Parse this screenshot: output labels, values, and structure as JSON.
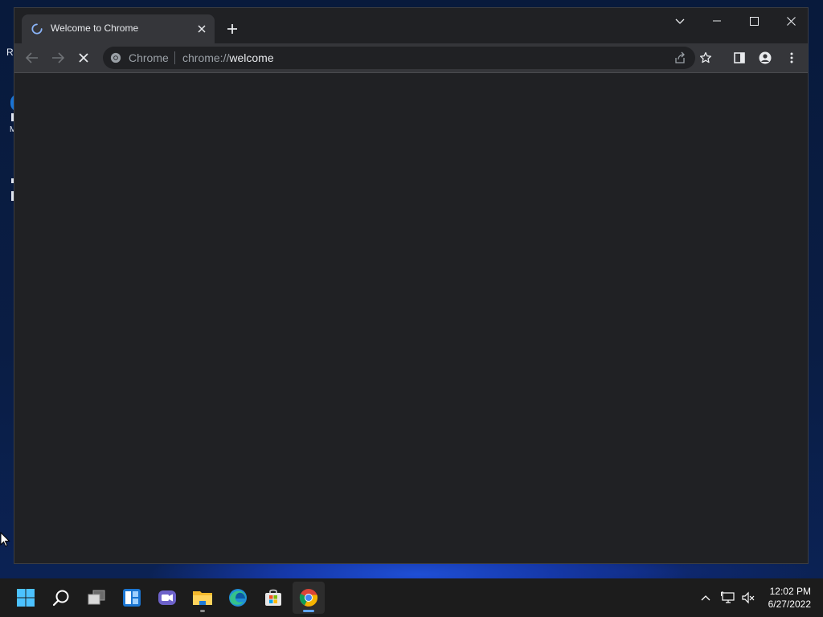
{
  "desktop": {
    "partial_labels": [
      "Re",
      "M"
    ]
  },
  "browser": {
    "tab": {
      "title": "Welcome to Chrome"
    },
    "omnibox": {
      "chip_label": "Chrome",
      "url_scheme": "chrome://",
      "url_host": "welcome"
    }
  },
  "taskbar": {
    "apps": [
      {
        "name": "start",
        "icon": "windows-logo-icon"
      },
      {
        "name": "search",
        "icon": "search-icon"
      },
      {
        "name": "task-view",
        "icon": "task-view-icon"
      },
      {
        "name": "widgets",
        "icon": "widgets-icon"
      },
      {
        "name": "teams-chat",
        "icon": "chat-icon"
      },
      {
        "name": "file-explorer",
        "icon": "folder-icon",
        "running": true
      },
      {
        "name": "edge",
        "icon": "edge-icon"
      },
      {
        "name": "store",
        "icon": "store-icon"
      },
      {
        "name": "chrome",
        "icon": "chrome-icon",
        "running": true,
        "active": true
      }
    ],
    "clock": {
      "time": "12:02 PM",
      "date": "6/27/2022"
    }
  },
  "colors": {
    "accent": "#60a5fa",
    "chrome_frame": "#202124",
    "chrome_toolbar": "#35363a"
  }
}
